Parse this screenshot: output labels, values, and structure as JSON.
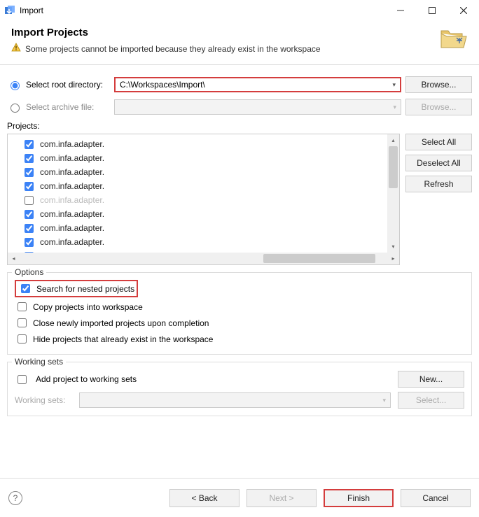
{
  "titlebar": {
    "title": "Import"
  },
  "header": {
    "title": "Import Projects",
    "subtitle": "Some projects cannot be imported because they already exist in the workspace"
  },
  "source": {
    "radio_root": "Select root directory:",
    "radio_archive": "Select archive file:",
    "root_value": "C:\\Workspaces\\Import\\",
    "archive_value": "",
    "browse": "Browse...",
    "browse_disabled": "Browse..."
  },
  "projects": {
    "label": "Projects:",
    "items": [
      {
        "label": "com.infa.adapter.",
        "checked": true,
        "dim": false
      },
      {
        "label": "com.infa.adapter.",
        "checked": true,
        "dim": false
      },
      {
        "label": "com.infa.adapter.",
        "checked": true,
        "dim": false
      },
      {
        "label": "com.infa.adapter.",
        "checked": true,
        "dim": false
      },
      {
        "label": "com.infa.adapter.",
        "checked": false,
        "dim": true
      },
      {
        "label": "com.infa.adapter.",
        "checked": true,
        "dim": false
      },
      {
        "label": "com.infa.adapter.",
        "checked": true,
        "dim": false
      },
      {
        "label": "com.infa.adapter.",
        "checked": true,
        "dim": false
      },
      {
        "label": "com.infa.adapter.",
        "checked": true,
        "dim": false
      }
    ],
    "buttons": {
      "select_all": "Select All",
      "deselect_all": "Deselect All",
      "refresh": "Refresh"
    }
  },
  "options": {
    "title": "Options",
    "search_nested": "Search for nested projects",
    "copy_into_workspace": "Copy projects into workspace",
    "close_on_complete": "Close newly imported projects upon completion",
    "hide_existing": "Hide projects that already exist in the workspace"
  },
  "working_sets": {
    "title": "Working sets",
    "add_to_ws": "Add project to working sets",
    "new": "New...",
    "label": "Working sets:",
    "select": "Select..."
  },
  "footer": {
    "back": "< Back",
    "next": "Next >",
    "finish": "Finish",
    "cancel": "Cancel"
  }
}
